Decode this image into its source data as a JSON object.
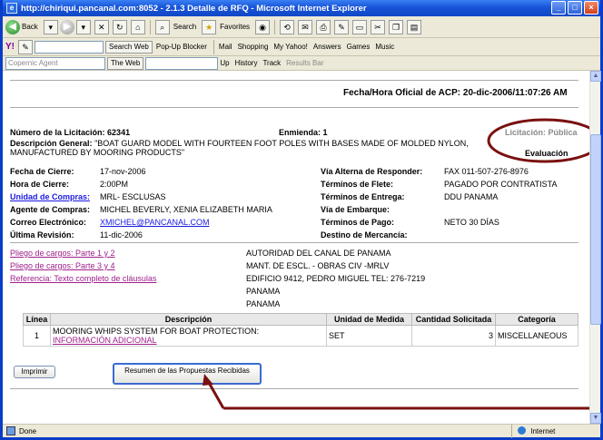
{
  "window": {
    "title": "http://chiriqui.pancanal.com:8052 - 2.1.3 Detalle de RFQ - Microsoft Internet Explorer",
    "minimize": "_",
    "maximize": "□",
    "close": "×"
  },
  "toolbar": {
    "back": "Back",
    "search": "Search",
    "favorites": "Favorites"
  },
  "toolbar2": {
    "search_web": "Search Web",
    "popup_blocker": "Pop-Up Blocker",
    "mail": "Mail",
    "shopping": "Shopping",
    "my_yahoo": "My Yahoo!",
    "answers": "Answers",
    "games": "Games",
    "music": "Music"
  },
  "toolbar3": {
    "copernic": "Copernic Agent",
    "the_web": "The Web",
    "up": "Up",
    "history": "History",
    "track": "Track",
    "results_bar": "Results Bar"
  },
  "page": {
    "official_time": "Fecha/Hora Oficial de ACP: 20-dic-2006/11:07:26 AM",
    "licitacion_label": "Número de la Licitación:",
    "licitacion_value": "62341",
    "enmienda": "Enmienda: 1",
    "licitacion_type": "Licitación: Pública",
    "evaluacion": "Evaluación",
    "desc_label": "Descripción General:",
    "desc_value": "\"BOAT GUARD MODEL WITH FOURTEEN FOOT POLES WITH BASES MADE OF MOLDED NYLON, MANUFACTURED BY MOORING PRODUCTS\"",
    "left_fields": [
      {
        "label": "Fecha de Cierre:",
        "value": "17-nov-2006"
      },
      {
        "label": "Hora de Cierre:",
        "value": "2:00PM"
      },
      {
        "label": "Unidad de Compras:",
        "value": "MRL- ESCLUSAS"
      },
      {
        "label": "Agente de Compras:",
        "value": "MICHEL BEVERLY, XENIA ELIZABETH MARIA"
      },
      {
        "label": "Correo Electrónico:",
        "value": "XMICHEL@PANCANAL.COM"
      },
      {
        "label": "Última Revisión:",
        "value": "11-dic-2006"
      }
    ],
    "right_fields": [
      {
        "label": "Vía Alterna de Responder:",
        "value": "FAX 011-507-276-8976"
      },
      {
        "label": "Términos de Flete:",
        "value": "PAGADO POR CONTRATISTA"
      },
      {
        "label": "Términos de Entrega:",
        "value": "DDU PANAMA"
      },
      {
        "label": "Vía de Embarque:",
        "value": ""
      },
      {
        "label": "Términos de Pago:",
        "value": "NETO 30 DÍAS"
      },
      {
        "label": "Destino de Mercancía:",
        "value": ""
      }
    ],
    "links": [
      "Pliego de cargos: Parte 1 y 2",
      "Pliego de cargos: Parte 3 y 4",
      "Referencia: Texto completo de cláusulas"
    ],
    "address": [
      "AUTORIDAD DEL CANAL DE PANAMA",
      "MANT. DE ESCL. - OBRAS CIV -MRLV",
      "EDIFICIO 9412, PEDRO MIGUEL  TEL: 276-7219",
      "PANAMA",
      "PANAMA"
    ],
    "table": {
      "headers": [
        "Línea",
        "Descripción",
        "Unidad de Medida",
        "Cantidad Solicitada",
        "Categoría"
      ],
      "rows": [
        {
          "linea": "1",
          "descripcion": "MOORING WHIPS SYSTEM FOR BOAT PROTECTION:",
          "info_link": "INFORMACIÓN ADICIONAL",
          "unidad": "SET",
          "cantidad": "3",
          "categoria": "MISCELLANEOUS"
        }
      ]
    },
    "print_button": "Imprimir",
    "summary_button": "Resumen de las Propuestas Recibidas"
  },
  "status": {
    "left": "Done",
    "zone": "Internet"
  },
  "colors": {
    "title_blue": "#1854d8",
    "link_blue": "#1a1ae0",
    "link_purple": "#a0208c",
    "annotation_red": "#7a1010"
  }
}
